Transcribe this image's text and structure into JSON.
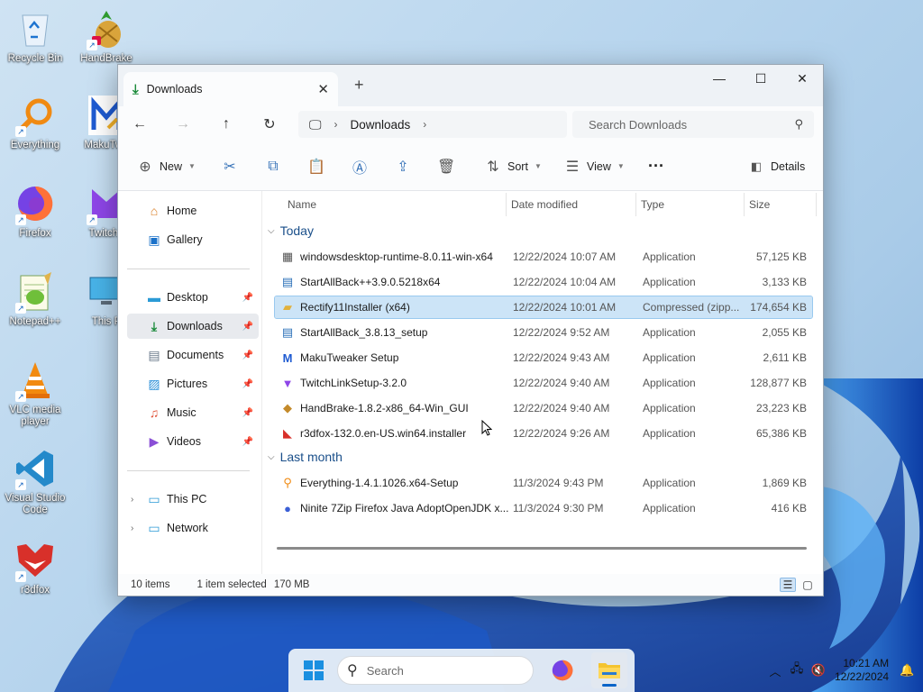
{
  "desktop": {
    "icons": [
      {
        "label": "Recycle Bin",
        "icon": "recycle-bin-icon"
      },
      {
        "label": "HandBrake",
        "icon": "handbrake-icon"
      },
      {
        "label": "Everything",
        "icon": "everything-icon"
      },
      {
        "label": "MakuTwe",
        "icon": "makutweaker-icon"
      },
      {
        "label": "Firefox",
        "icon": "firefox-icon"
      },
      {
        "label": "TwitchL",
        "icon": "twitch-icon"
      },
      {
        "label": "Notepad++",
        "icon": "notepadpp-icon"
      },
      {
        "label": "This P",
        "icon": "this-pc-icon"
      },
      {
        "label": "VLC media player",
        "icon": "vlc-icon"
      },
      {
        "label": "Visual Studio Code",
        "icon": "vscode-icon"
      },
      {
        "label": "r3dfox",
        "icon": "r3dfox-icon"
      }
    ]
  },
  "window": {
    "tab_title": "Downloads",
    "new_tab_symbol": "+",
    "breadcrumb": {
      "current": "Downloads"
    },
    "search_placeholder": "Search Downloads",
    "toolbar": {
      "new_label": "New",
      "sort_label": "Sort",
      "view_label": "View",
      "details_label": "Details"
    },
    "sidebar": {
      "home": "Home",
      "gallery": "Gallery",
      "desktop": "Desktop",
      "downloads": "Downloads",
      "documents": "Documents",
      "pictures": "Pictures",
      "music": "Music",
      "videos": "Videos",
      "this_pc": "This PC",
      "network": "Network"
    },
    "columns": {
      "name": "Name",
      "date": "Date modified",
      "type": "Type",
      "size": "Size"
    },
    "groups": {
      "today": "Today",
      "last_month": "Last month"
    },
    "files": [
      {
        "name": "windowsdesktop-runtime-8.0.11-win-x64",
        "date": "12/22/2024 10:07 AM",
        "type": "Application",
        "size": "57,125 KB",
        "icon": "dotnet-installer-icon"
      },
      {
        "name": "StartAllBack++3.9.0.5218x64",
        "date": "12/22/2024 10:04 AM",
        "type": "Application",
        "size": "3,133 KB",
        "icon": "startallback-icon"
      },
      {
        "name": "Rectify11Installer (x64)",
        "date": "12/22/2024 10:01 AM",
        "type": "Compressed (zipp...",
        "size": "174,654 KB",
        "icon": "zip-folder-icon"
      },
      {
        "name": "StartAllBack_3.8.13_setup",
        "date": "12/22/2024 9:52 AM",
        "type": "Application",
        "size": "2,055 KB",
        "icon": "startallback-icon"
      },
      {
        "name": "MakuTweaker Setup",
        "date": "12/22/2024 9:43 AM",
        "type": "Application",
        "size": "2,611 KB",
        "icon": "makutweaker-icon"
      },
      {
        "name": "TwitchLinkSetup-3.2.0",
        "date": "12/22/2024 9:40 AM",
        "type": "Application",
        "size": "128,877 KB",
        "icon": "twitch-icon"
      },
      {
        "name": "HandBrake-1.8.2-x86_64-Win_GUI",
        "date": "12/22/2024 9:40 AM",
        "type": "Application",
        "size": "23,223 KB",
        "icon": "handbrake-icon"
      },
      {
        "name": "r3dfox-132.0.en-US.win64.installer",
        "date": "12/22/2024 9:26 AM",
        "type": "Application",
        "size": "65,386 KB",
        "icon": "r3dfox-icon"
      },
      {
        "name": "Everything-1.4.1.1026.x64-Setup",
        "date": "11/3/2024 9:43 PM",
        "type": "Application",
        "size": "1,869 KB",
        "icon": "everything-icon"
      },
      {
        "name": "Ninite 7Zip Firefox Java AdoptOpenJDK x...",
        "date": "11/3/2024 9:30 PM",
        "type": "Application",
        "size": "416 KB",
        "icon": "ninite-icon"
      }
    ],
    "status": {
      "count": "10 items",
      "selected": "1 item selected",
      "size": "170 MB"
    }
  },
  "taskbar": {
    "search_placeholder": "Search",
    "time": "10:21 AM",
    "date": "12/22/2024"
  },
  "colors": {
    "accent": "#0a64c8",
    "selected_row": "#cce4f7",
    "folder_green": "#1a8a3a"
  }
}
